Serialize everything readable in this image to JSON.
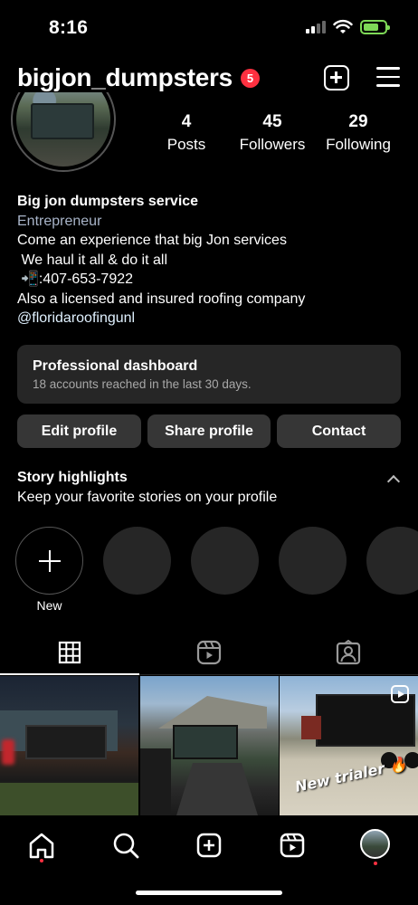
{
  "status": {
    "time": "8:16"
  },
  "header": {
    "username": "bigjon_dumpsters",
    "notification_count": "5"
  },
  "stats": [
    {
      "value": "4",
      "label": "Posts"
    },
    {
      "value": "45",
      "label": "Followers"
    },
    {
      "value": "29",
      "label": "Following"
    }
  ],
  "bio": {
    "name": "Big jon dumpsters service",
    "category": "Entrepreneur",
    "lines": [
      "Come an experience that big Jon services",
      " We haul it all & do it all",
      "📲:407-653-7922",
      "Also a licensed and insured roofing company"
    ],
    "link": "@floridaroofingunl"
  },
  "dashboard": {
    "title": "Professional dashboard",
    "subtitle": "18 accounts reached in the last 30 days."
  },
  "actions": {
    "edit": "Edit profile",
    "share": "Share profile",
    "contact": "Contact"
  },
  "highlights": {
    "title": "Story highlights",
    "subtitle": "Keep your favorite stories on your profile",
    "new_label": "New"
  },
  "posts": [
    {
      "caption": ""
    },
    {
      "caption": ""
    },
    {
      "caption": "New trialer 🔥"
    }
  ]
}
